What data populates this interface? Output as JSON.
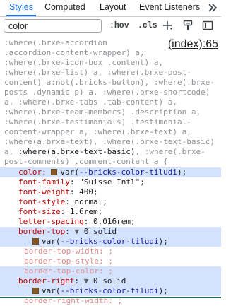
{
  "tabs": [
    {
      "label": "Styles",
      "active": true
    },
    {
      "label": "Computed",
      "active": false
    },
    {
      "label": "Layout",
      "active": false
    },
    {
      "label": "Event Listeners",
      "active": false
    }
  ],
  "more_tabs_icon": "chevron-double-right-icon",
  "toolbar": {
    "filter_value": "color",
    "hov_label": ":hov",
    "cls_label": ".cls",
    "icons": [
      "new-style-rule-icon",
      "element-state-paint-icon",
      "toggle-sidebar-icon"
    ]
  },
  "rule": {
    "source": "(index):65",
    "selector_lines": [
      ":where(.brxe-accordion",
      ".accordion-content-wrapper) a,",
      ":where(.brxe-icon-box .content) a,",
      ":where(.brxe-list) a, :where(.brxe-post-",
      "content) a:not(.bricks-button), :where(.brxe-",
      "posts .dynamic p) a, :where(.brxe-shortcode)",
      "a, :where(.brxe-tabs .tab-content) a,",
      ":where(.brxe-team-members) .description a,",
      ":where(.brxe-testimonials) .testimonial-",
      "content-wrapper a, :where(.brxe-text) a,",
      ":where(a.brxe-text), :where(.brxe-text-basic)",
      "a,",
      "post-comments) .comment-content a {"
    ],
    "selector_match": ":where(a.brxe-text-basic)",
    "selector_tail_dim": ", :where(.brxe-",
    "declarations": {
      "color": {
        "name": "color",
        "value_fn": "var(",
        "value_var": "--bricks-color-tiludi",
        "value_end": ");"
      },
      "font_family": {
        "name": "font-family",
        "value": "\"Suisse Intl\";"
      },
      "font_weight": {
        "name": "font-weight",
        "value": "400;"
      },
      "font_style": {
        "name": "font-style",
        "value": "normal;"
      },
      "font_size": {
        "name": "font-size",
        "value": "1.6rem;"
      },
      "letter_spacing": {
        "name": "letter-spacing",
        "value": "0.016rem;"
      },
      "border_top": {
        "name": "border-top",
        "value_pre": "0 solid",
        "value_fn": "var(",
        "value_var": "--bricks-color-tiludi",
        "value_end": ");"
      },
      "border_top_width": {
        "name": "border-top-width",
        "value": ";"
      },
      "border_top_style": {
        "name": "border-top-style",
        "value": ";"
      },
      "border_top_color": {
        "name": "border-top-color",
        "value": ";"
      },
      "border_right": {
        "name": "border-right",
        "value_pre": "0 solid",
        "value_fn": "var(",
        "value_var": "--bricks-color-tiludi",
        "value_end": ");"
      },
      "border_right_width": {
        "name": "border-right-width",
        "value": ";"
      }
    },
    "swatch_color": "#8a5a24",
    "colon": ":",
    "triangle": "▼"
  }
}
